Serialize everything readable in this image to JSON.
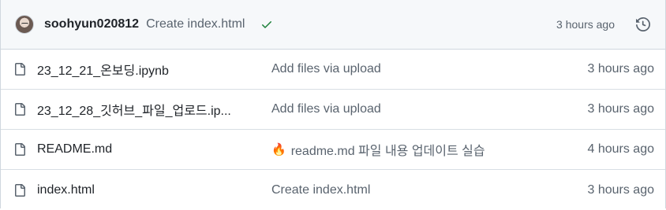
{
  "latest_commit": {
    "author": "soohyun020812",
    "message": "Create index.html",
    "status": "success",
    "time": "3 hours ago"
  },
  "icons": {
    "history": "history-icon",
    "file": "file-icon",
    "check": "check-icon",
    "fire": "fire-emoji"
  },
  "colors": {
    "success": "#1a7f37",
    "muted": "#59636e",
    "header_bg": "#f6f8fa"
  },
  "files": [
    {
      "name": "23_12_21_온보딩.ipynb",
      "message": "Add files via upload",
      "time": "3 hours ago",
      "emoji": ""
    },
    {
      "name": "23_12_28_깃허브_파일_업로드.ip...",
      "message": "Add files via upload",
      "time": "3 hours ago",
      "emoji": ""
    },
    {
      "name": "README.md",
      "message": "readme.md 파일 내용 업데이트 실습",
      "time": "4 hours ago",
      "emoji": "🔥"
    },
    {
      "name": "index.html",
      "message": "Create index.html",
      "time": "3 hours ago",
      "emoji": ""
    }
  ]
}
